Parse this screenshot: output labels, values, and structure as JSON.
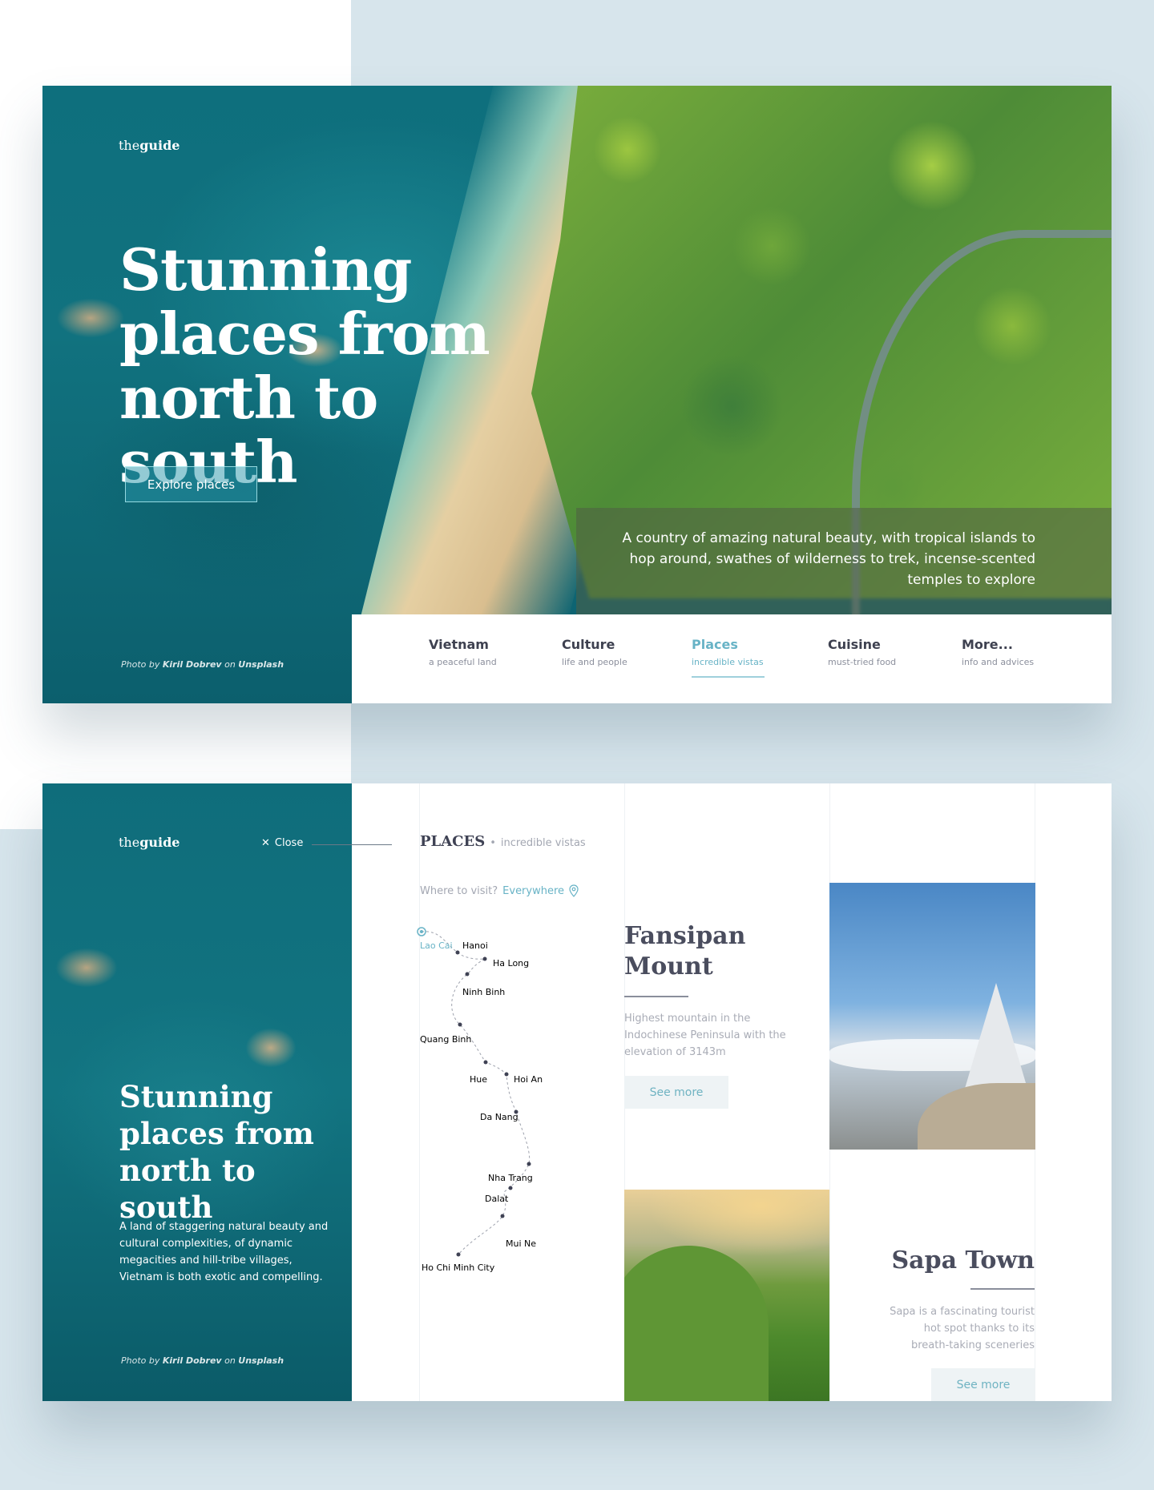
{
  "brand": {
    "prefix": "the",
    "name": "guide"
  },
  "hero": {
    "title": "Stunning places from north to south",
    "button": "Explore places",
    "quote": "A country of amazing natural beauty, with tropical islands to hop around, swathes of wilderness to trek, incense-scented temples to explore",
    "credit_prefix": "Photo by",
    "credit_author": "Kiril Dobrev",
    "credit_on": "on",
    "credit_site": "Unsplash"
  },
  "nav": [
    {
      "title": "Vietnam",
      "subtitle": "a peaceful land"
    },
    {
      "title": "Culture",
      "subtitle": "life and people"
    },
    {
      "title": "Places",
      "subtitle": "incredible vistas",
      "active": true
    },
    {
      "title": "Cuisine",
      "subtitle": "must-tried food"
    },
    {
      "title": "More...",
      "subtitle": "info and advices"
    }
  ],
  "places_page": {
    "close": "Close",
    "title": "Stunning places from north to south",
    "description": "A land of staggering natural beauty and cultural complexities, of dynamic megacities and hill-tribe villages, Vietnam is both exotic and compelling.",
    "heading": "PLACES",
    "heading_sub": "incredible vistas",
    "where_label": "Where to visit?",
    "where_value": "Everywhere",
    "cities": [
      "Lao Cai",
      "Hanoi",
      "Ha Long",
      "Ninh Binh",
      "Quang Binh",
      "Hue",
      "Hoi An",
      "Da Nang",
      "Nha Trang",
      "Dalat",
      "Mui Ne",
      "Ho Chi Minh City"
    ],
    "selected_city": "Lao Cai",
    "place1": {
      "title_line1": "Fansipan",
      "title_line2": "Mount",
      "description": "Highest mountain in the Indochinese Peninsula  with the elevation of 3143m",
      "button": "See more"
    },
    "place2": {
      "title": "Sapa Town",
      "description": "Sapa is a fascinating tourist hot spot thanks to its breath-taking sceneries",
      "button": "See more"
    }
  },
  "colors": {
    "accent": "#68b3c6",
    "dark_text": "#3f4254",
    "muted_text": "#a3a7b2",
    "background_blue": "#d7e5ec"
  }
}
